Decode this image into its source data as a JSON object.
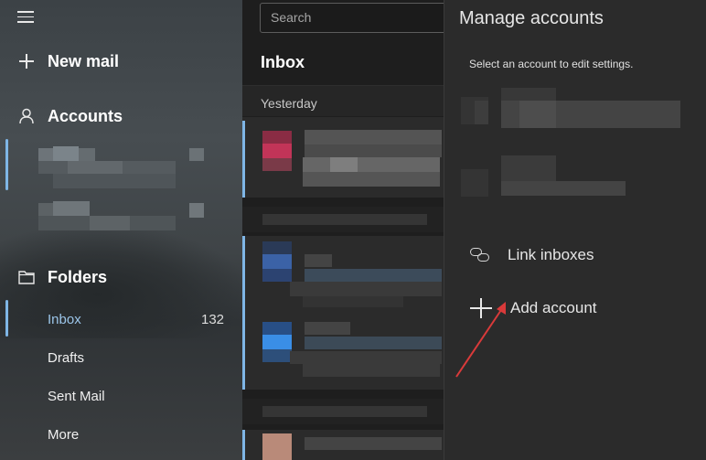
{
  "sidebar": {
    "new_mail": "New mail",
    "accounts": "Accounts",
    "folders": "Folders",
    "folder_items": [
      {
        "label": "Inbox",
        "count": "132"
      },
      {
        "label": "Drafts"
      },
      {
        "label": "Sent Mail"
      },
      {
        "label": "More"
      }
    ]
  },
  "list": {
    "search_placeholder": "Search",
    "title": "Inbox",
    "day_header": "Yesterday"
  },
  "panel": {
    "title": "Manage accounts",
    "subtitle": "Select an account to edit settings.",
    "link_inboxes": "Link inboxes",
    "add_account": "Add account"
  },
  "colors": {
    "accent": "#7fb6e6",
    "annotation_arrow": "#d93a3a"
  },
  "icons": [
    "hamburger-icon",
    "plus-icon",
    "person-icon",
    "folder-icon",
    "link-icon",
    "add-icon"
  ]
}
